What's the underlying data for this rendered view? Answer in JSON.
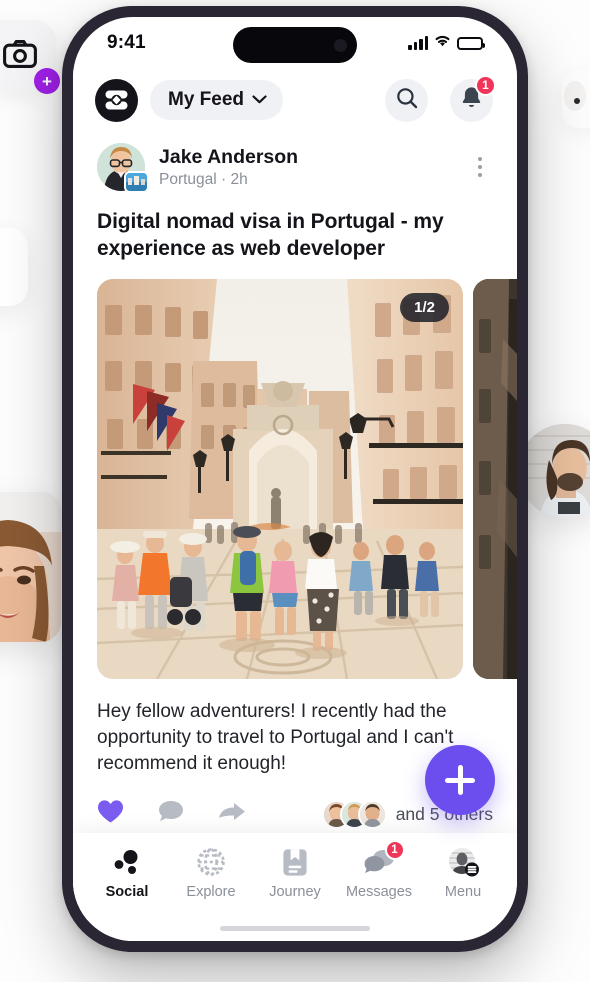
{
  "status_bar": {
    "time": "9:41",
    "cellular_icon": "signal-bars-icon",
    "wifi_icon": "wifi-icon",
    "battery_icon": "battery-full-icon"
  },
  "header": {
    "logo_icon": "app-logo-icon",
    "feed_selector_label": "My Feed",
    "feed_selector_chevron": "chevron-down-icon",
    "search_icon": "search-icon",
    "notifications_icon": "bell-icon",
    "notifications_badge": "1"
  },
  "post": {
    "author": "Jake Anderson",
    "meta": "Portugal · 2h",
    "location": "Portugal",
    "time_ago": "2h",
    "more_icon": "more-vertical-icon",
    "title": "Digital nomad visa in Portugal - my experience as web developer",
    "carousel_counter": "1/2",
    "body": "Hey fellow adventurers! I recently had the opportunity to travel to Portugal and I can't recommend it enough!",
    "actions": {
      "like_icon": "heart-filled-icon",
      "comment_icon": "comment-icon",
      "share_icon": "share-arrow-icon"
    },
    "likes_text": "and 5 others"
  },
  "next_post": {
    "author": "Jake Anderson"
  },
  "fab": {
    "icon": "plus-icon",
    "label": "Create post"
  },
  "bottom_nav": {
    "items": [
      {
        "label": "Social",
        "icon": "social-dots-icon",
        "active": true,
        "badge": ""
      },
      {
        "label": "Explore",
        "icon": "globe-icon",
        "active": false,
        "badge": ""
      },
      {
        "label": "Journey",
        "icon": "journal-icon",
        "active": false,
        "badge": ""
      },
      {
        "label": "Messages",
        "icon": "chat-bubbles-icon",
        "active": false,
        "badge": "1"
      },
      {
        "label": "Menu",
        "icon": "menu-avatar-icon",
        "active": false,
        "badge": ""
      }
    ]
  },
  "background": {
    "camera_card_icon": "camera-icon",
    "camera_card_badge_icon": "plus-icon",
    "profile_card_left": "woman-photo",
    "profile_card_right": "man-avatar-photo"
  },
  "colors": {
    "accent_purple": "#6C4DED",
    "badge_red": "#F1355A",
    "text_primary": "#15141A",
    "text_muted": "#8A8F99",
    "chip_grey": "#F0F1F4",
    "plus_badge_purple": "#A020E8"
  }
}
